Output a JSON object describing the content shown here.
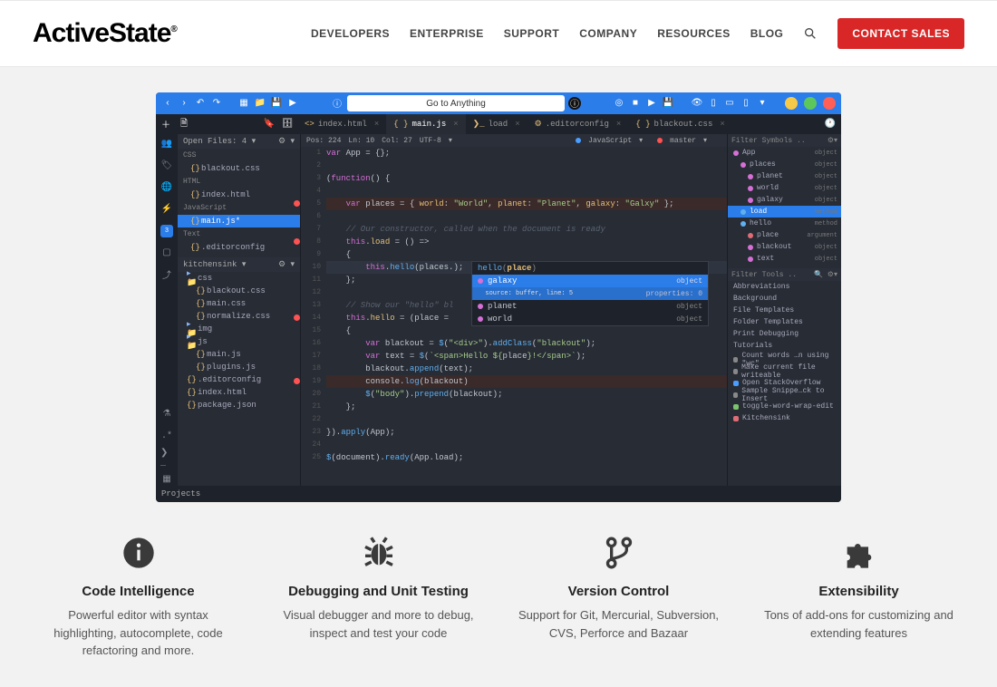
{
  "brand": "ActiveState",
  "nav": [
    "DEVELOPERS",
    "ENTERPRISE",
    "SUPPORT",
    "COMPANY",
    "RESOURCES",
    "BLOG"
  ],
  "sales_btn": "CONTACT SALES",
  "ide": {
    "go_to": "Go to Anything",
    "open_files_label": "Open Files: 4",
    "projects_label": "Projects",
    "tabs": [
      {
        "icon": "<>",
        "label": "index.html"
      },
      {
        "icon": "{ }",
        "label": "main.js",
        "active": true
      },
      {
        "icon": "❯_",
        "label": "load"
      },
      {
        "icon": "⚙",
        "label": ".editorconfig"
      },
      {
        "icon": "{ }",
        "label": "blackout.css"
      }
    ],
    "status": {
      "pos": "Pos: 224",
      "ln": "Ln: 10",
      "col": "Col: 27",
      "enc": "UTF-8",
      "lang": "JavaScript",
      "branch": "master"
    },
    "files_panel": {
      "groups": [
        {
          "name": "CSS",
          "items": [
            "blackout.css"
          ]
        },
        {
          "name": "HTML",
          "items": [
            "index.html"
          ]
        },
        {
          "name": "JavaScript",
          "items": [
            "main.js*"
          ],
          "selected": 0
        },
        {
          "name": "Text",
          "items": [
            ".editorconfig"
          ]
        }
      ],
      "project": "kitchensink",
      "tree": [
        {
          "label": "css",
          "depth": 0,
          "folder": true
        },
        {
          "label": "blackout.css",
          "depth": 1
        },
        {
          "label": "main.css",
          "depth": 1
        },
        {
          "label": "normalize.css",
          "depth": 1
        },
        {
          "label": "img",
          "depth": 0,
          "folder": true
        },
        {
          "label": "js",
          "depth": 0,
          "folder": true
        },
        {
          "label": "main.js",
          "depth": 1
        },
        {
          "label": "plugins.js",
          "depth": 1
        },
        {
          "label": ".editorconfig",
          "depth": 0
        },
        {
          "label": "index.html",
          "depth": 0
        },
        {
          "label": "package.json",
          "depth": 0
        }
      ]
    },
    "code_lines": [
      {
        "n": 1,
        "html": "<span class='c-key'>var</span> App = {};"
      },
      {
        "n": 2,
        "html": ""
      },
      {
        "n": 3,
        "html": "(<span class='c-key'>function</span>() {"
      },
      {
        "n": 4,
        "html": ""
      },
      {
        "n": 5,
        "bp": true,
        "cls": "hl-err",
        "html": "    <span class='c-key'>var</span> places = { <span class='c-prop'>world</span>: <span class='c-str'>\"World\"</span>, <span class='c-prop'>planet</span>: <span class='c-str'>\"Planet\"</span>, <span class='c-prop'>galaxy</span>: <span class='c-str'>\"Galxy\"</span> };"
      },
      {
        "n": 6,
        "html": ""
      },
      {
        "n": 7,
        "html": "    <span class='c-com'>// Our constructor, called when the document is ready</span>"
      },
      {
        "n": 8,
        "bp": true,
        "html": "    <span class='c-this'>this</span>.<span class='c-prop'>load</span> = () =>"
      },
      {
        "n": 9,
        "html": "    {"
      },
      {
        "n": 10,
        "cls": "hl",
        "html": "        <span class='c-this'>this</span>.<span class='c-fn'>hello</span>(places.);"
      },
      {
        "n": 11,
        "html": "    };"
      },
      {
        "n": 12,
        "html": ""
      },
      {
        "n": 13,
        "html": "    <span class='c-com'>// Show our \"hello\" bl</span>"
      },
      {
        "n": 14,
        "bp": true,
        "html": "    <span class='c-this'>this</span>.<span class='c-prop'>hello</span> = (place ="
      },
      {
        "n": 15,
        "html": "    {"
      },
      {
        "n": 16,
        "html": "        <span class='c-key'>var</span> blackout = <span class='c-fn'>$</span>(<span class='c-str'>\"&lt;div&gt;\"</span>).<span class='c-fn'>addClass</span>(<span class='c-str'>\"blackout\"</span>);"
      },
      {
        "n": 17,
        "html": "        <span class='c-key'>var</span> text = <span class='c-fn'>$</span>(<span class='c-str'>`&lt;span&gt;Hello ${</span>place<span class='c-str'>}!&lt;/span&gt;`</span>);"
      },
      {
        "n": 18,
        "html": "        blackout.<span class='c-fn'>append</span>(text);"
      },
      {
        "n": 19,
        "bp": true,
        "cls": "hl-err",
        "html": "        console.<span class='c-fn'>log</span>(blackout)"
      },
      {
        "n": 20,
        "html": "        <span class='c-fn'>$</span>(<span class='c-str'>\"body\"</span>).<span class='c-fn'>prepend</span>(blackout);"
      },
      {
        "n": 21,
        "html": "    };"
      },
      {
        "n": 22,
        "html": ""
      },
      {
        "n": 23,
        "html": "}).<span class='c-fn'>apply</span>(App);"
      },
      {
        "n": 24,
        "html": ""
      },
      {
        "n": 25,
        "html": "<span class='c-fn'>$</span>(document).<span class='c-fn'>ready</span>(App.load);"
      }
    ],
    "autocomplete": {
      "hint_fn": "hello",
      "hint_arg": "place",
      "rows": [
        {
          "label": "galaxy",
          "kind": "object",
          "sub": "source: buffer, line: 5",
          "sel": true,
          "color": "#d670d6"
        },
        {
          "label": "planet",
          "kind": "object",
          "color": "#d670d6"
        },
        {
          "label": "world",
          "kind": "object",
          "color": "#d670d6"
        }
      ]
    },
    "outline": {
      "filter1": "Filter Symbols ..",
      "symbols": [
        {
          "label": "App",
          "kind": "object",
          "indent": 0,
          "color": "#d670d6"
        },
        {
          "label": "places",
          "kind": "object",
          "indent": 1,
          "color": "#d670d6"
        },
        {
          "label": "planet",
          "kind": "object",
          "indent": 2,
          "color": "#d670d6"
        },
        {
          "label": "world",
          "kind": "object",
          "indent": 2,
          "color": "#d670d6"
        },
        {
          "label": "galaxy",
          "kind": "object",
          "indent": 2,
          "color": "#d670d6"
        },
        {
          "label": "load",
          "kind": "method",
          "indent": 1,
          "sel": true,
          "color": "#61afef"
        },
        {
          "label": "hello",
          "kind": "method",
          "indent": 1,
          "color": "#61afef"
        },
        {
          "label": "place",
          "kind": "argument",
          "indent": 2,
          "color": "#e06c75"
        },
        {
          "label": "blackout",
          "kind": "object",
          "indent": 2,
          "color": "#d670d6"
        },
        {
          "label": "text",
          "kind": "object",
          "indent": 2,
          "color": "#d670d6"
        }
      ],
      "filter2": "Filter Tools ..",
      "tools": [
        "Abbreviations",
        "Background",
        "File Templates",
        "Folder Templates",
        "Print Debugging",
        "Tutorials"
      ],
      "snippets": [
        {
          "label": "Count words …n using \"wc\"",
          "color": "#888"
        },
        {
          "label": "Make current file writeable",
          "color": "#888"
        },
        {
          "label": "Open StackOverflow",
          "color": "#4a9eff"
        },
        {
          "label": "Sample Snippe…ck to Insert",
          "color": "#888"
        },
        {
          "label": "toggle-word-wrap-edit",
          "color": "#7cc36e"
        },
        {
          "label": "Kitchensink",
          "color": "#e06c75"
        }
      ]
    }
  },
  "features": [
    {
      "title": "Code Intelligence",
      "desc": "Powerful editor with syntax highlighting, autocomplete, code refactoring and more."
    },
    {
      "title": "Debugging and Unit Testing",
      "desc": "Visual debugger and more to debug, inspect and test your code"
    },
    {
      "title": "Version Control",
      "desc": "Support for Git, Mercurial, Subversion, CVS, Perforce and Bazaar"
    },
    {
      "title": "Extensibility",
      "desc": "Tons of add-ons for customizing and extending features"
    }
  ]
}
